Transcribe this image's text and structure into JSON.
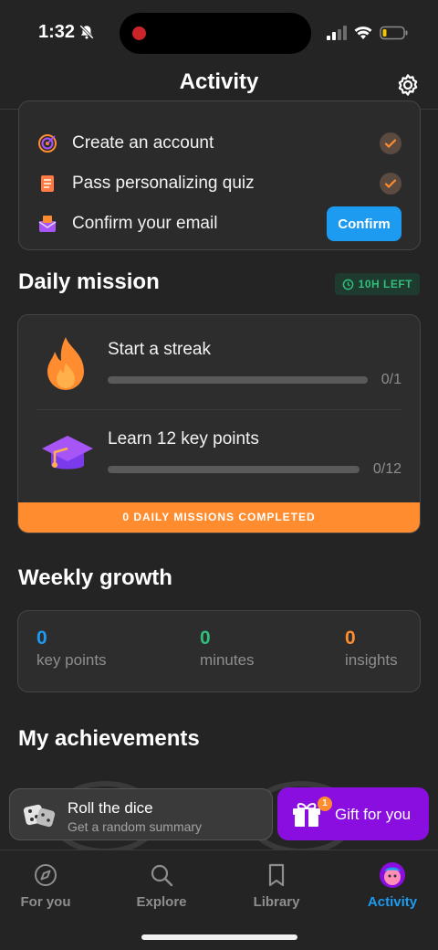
{
  "status_bar": {
    "time": "1:32"
  },
  "header": {
    "title": "Activity"
  },
  "onboarding": {
    "items": [
      {
        "label": "Create an account",
        "icon": "target-icon",
        "done": true
      },
      {
        "label": "Pass personalizing quiz",
        "icon": "notepad-icon",
        "done": true
      },
      {
        "label": "Confirm your email",
        "icon": "envelope-icon",
        "action": "Confirm"
      }
    ]
  },
  "daily_mission": {
    "title": "Daily mission",
    "time_left": "10H LEFT",
    "missions": [
      {
        "label": "Start a streak",
        "progress": "0/1",
        "fraction": 0,
        "icon": "flame-icon"
      },
      {
        "label": "Learn 12 key points",
        "progress": "0/12",
        "fraction": 0,
        "icon": "graduation-cap-icon"
      }
    ],
    "footer": "0 DAILY MISSIONS COMPLETED"
  },
  "weekly_growth": {
    "title": "Weekly growth",
    "stats": [
      {
        "value": "0",
        "label": "key points",
        "color": "#1d9bf0"
      },
      {
        "value": "0",
        "label": "minutes",
        "color": "#2fbf7a"
      },
      {
        "value": "0",
        "label": "insights",
        "color": "#ff8c2e"
      }
    ]
  },
  "achievements": {
    "title": "My achievements"
  },
  "dice": {
    "title": "Roll the dice",
    "subtitle": "Get a random summary"
  },
  "gift": {
    "label": "Gift for you",
    "badge": "1"
  },
  "tabs": [
    {
      "label": "For you",
      "icon": "compass-icon"
    },
    {
      "label": "Explore",
      "icon": "search-icon"
    },
    {
      "label": "Library",
      "icon": "bookmark-icon"
    },
    {
      "label": "Activity",
      "icon": "avatar-icon",
      "active": true
    }
  ],
  "colors": {
    "accent": "#1d9bf0",
    "orange": "#ff8c2e",
    "purple": "#8a0ee0",
    "green": "#2fbf7a"
  }
}
